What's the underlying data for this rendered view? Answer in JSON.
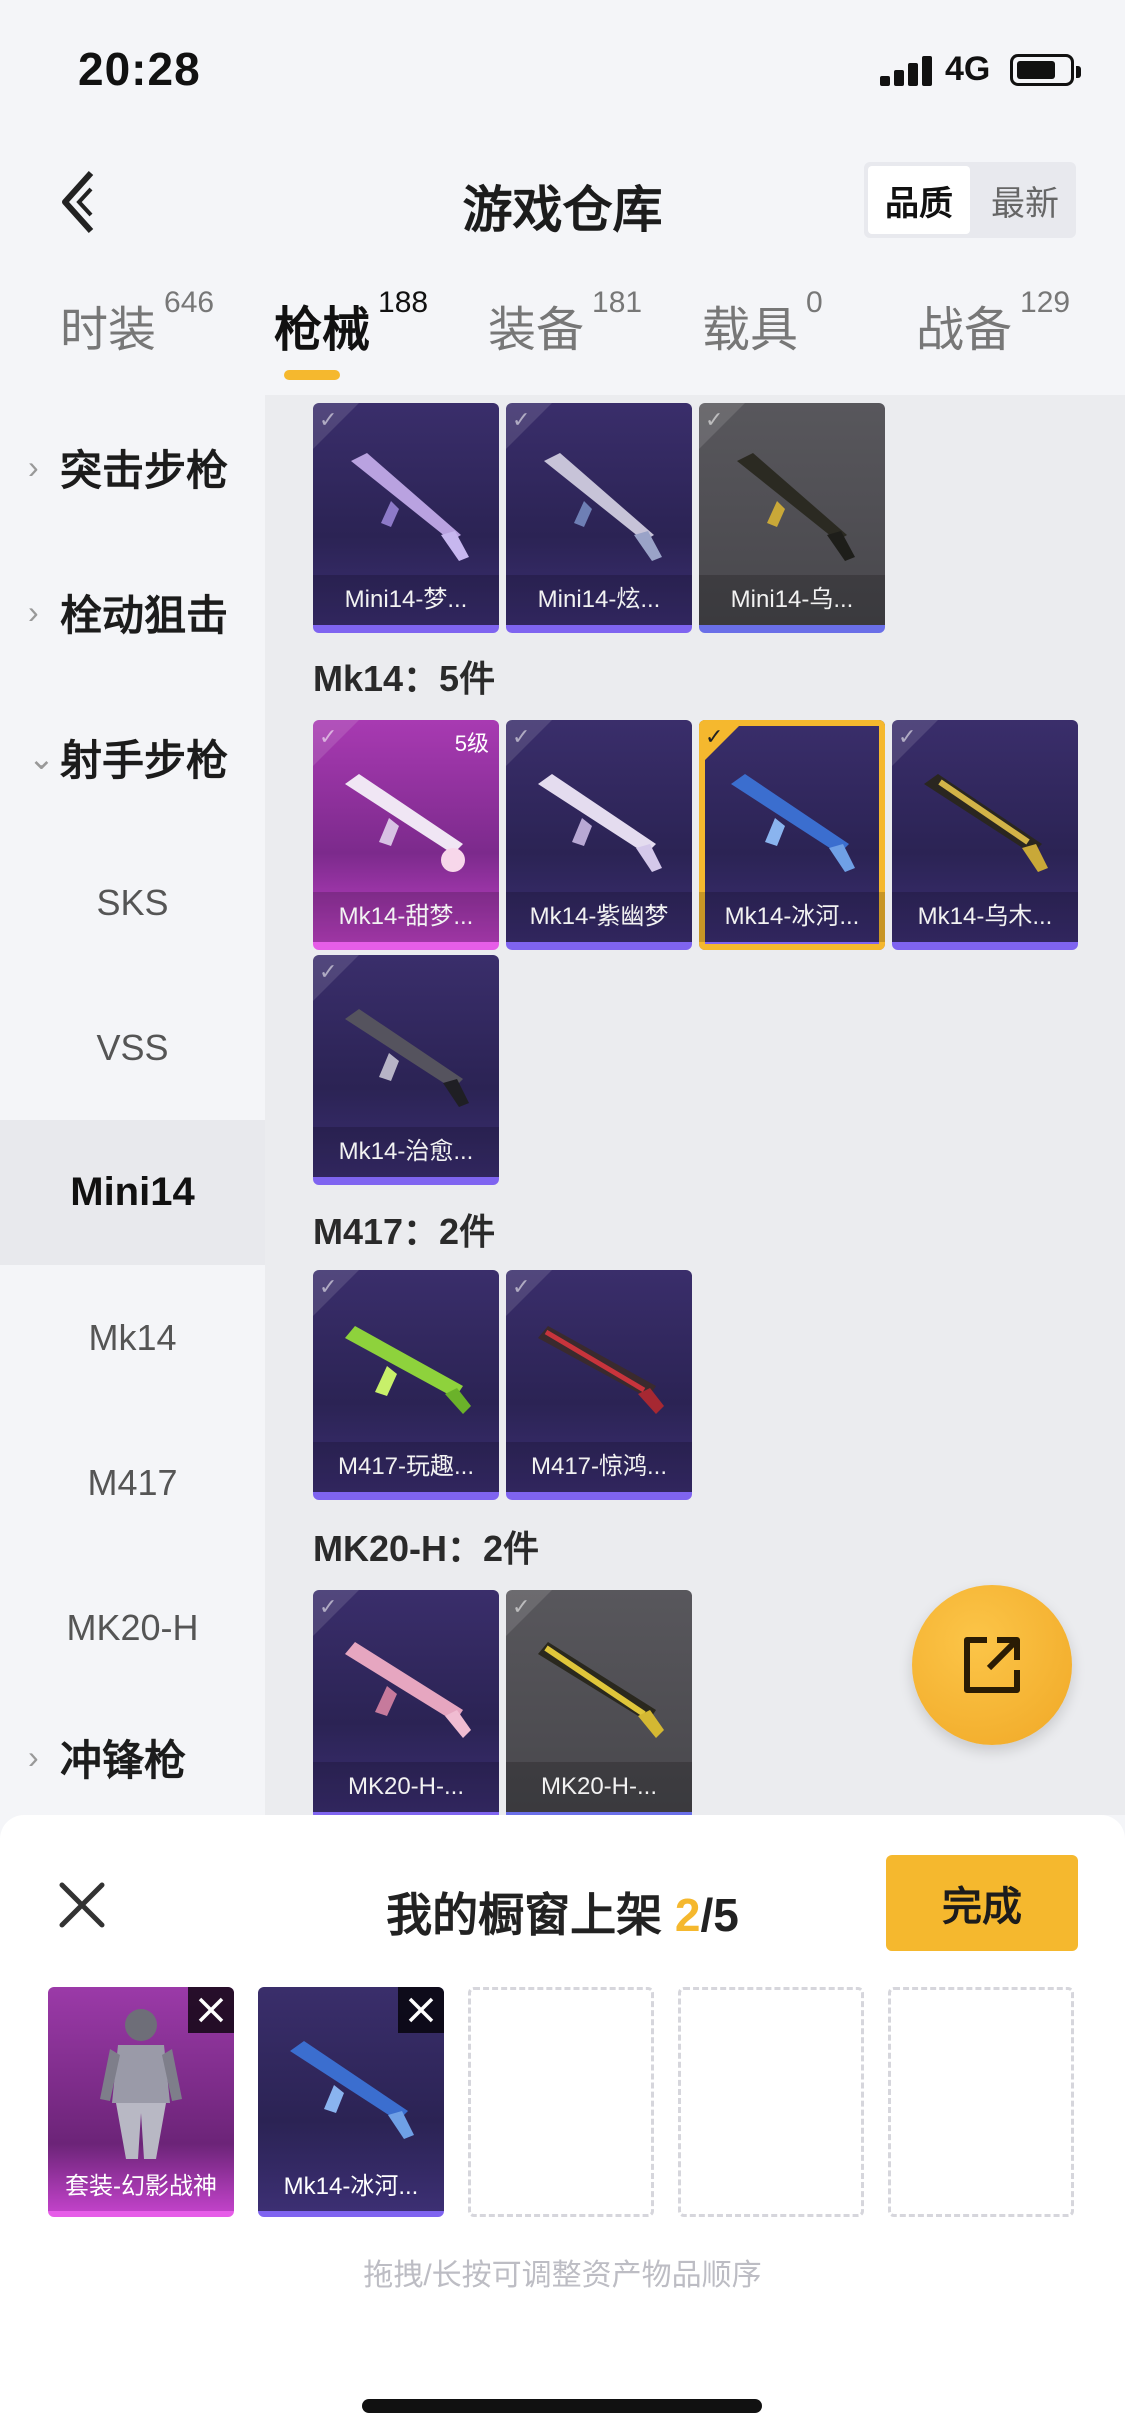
{
  "status_bar": {
    "time": "20:28",
    "network": "4G"
  },
  "header": {
    "title": "游戏仓库",
    "back_icon": "back-arrow-icon",
    "sort": {
      "quality": "品质",
      "newest": "最新"
    }
  },
  "tabs": [
    {
      "label": "时装",
      "count": "646"
    },
    {
      "label": "枪械",
      "count": "188"
    },
    {
      "label": "装备",
      "count": "181"
    },
    {
      "label": "载具",
      "count": "0"
    },
    {
      "label": "战备",
      "count": "129"
    }
  ],
  "categories": {
    "assault": "突击步枪",
    "bolt": "栓动狙击",
    "marksman": "射手步枪",
    "sks": "SKS",
    "vss": "VSS",
    "mini14": "Mini14",
    "mk14": "Mk14",
    "m417": "M417",
    "mk20h": "MK20-H",
    "smg": "冲锋枪"
  },
  "sections": {
    "mini14": {
      "items": [
        "Mini14-梦...",
        "Mini14-炫...",
        "Mini14-乌..."
      ]
    },
    "mk14": {
      "title": "Mk14：5件",
      "level_tag": "5级",
      "items": [
        "Mk14-甜梦...",
        "Mk14-紫幽梦",
        "Mk14-冰河...",
        "Mk14-乌木...",
        "Mk14-治愈..."
      ]
    },
    "m417": {
      "title": "M417：2件",
      "items": [
        "M417-玩趣...",
        "M417-惊鸿..."
      ]
    },
    "mk20h": {
      "title": "MK20-H：2件",
      "items": [
        "MK20-H-...",
        "MK20-H-..."
      ]
    }
  },
  "sheet": {
    "title_prefix": "我的橱窗上架 ",
    "count_current": "2",
    "count_total": "/5",
    "done": "完成",
    "slots": [
      "套装-幻影战神",
      "Mk14-冰河..."
    ],
    "hint": "拖拽/长按可调整资产物品顺序"
  },
  "colors": {
    "accent": "#f5b82e",
    "rarity_purple": "#7f64f0",
    "rarity_pink": "#e65de8"
  }
}
